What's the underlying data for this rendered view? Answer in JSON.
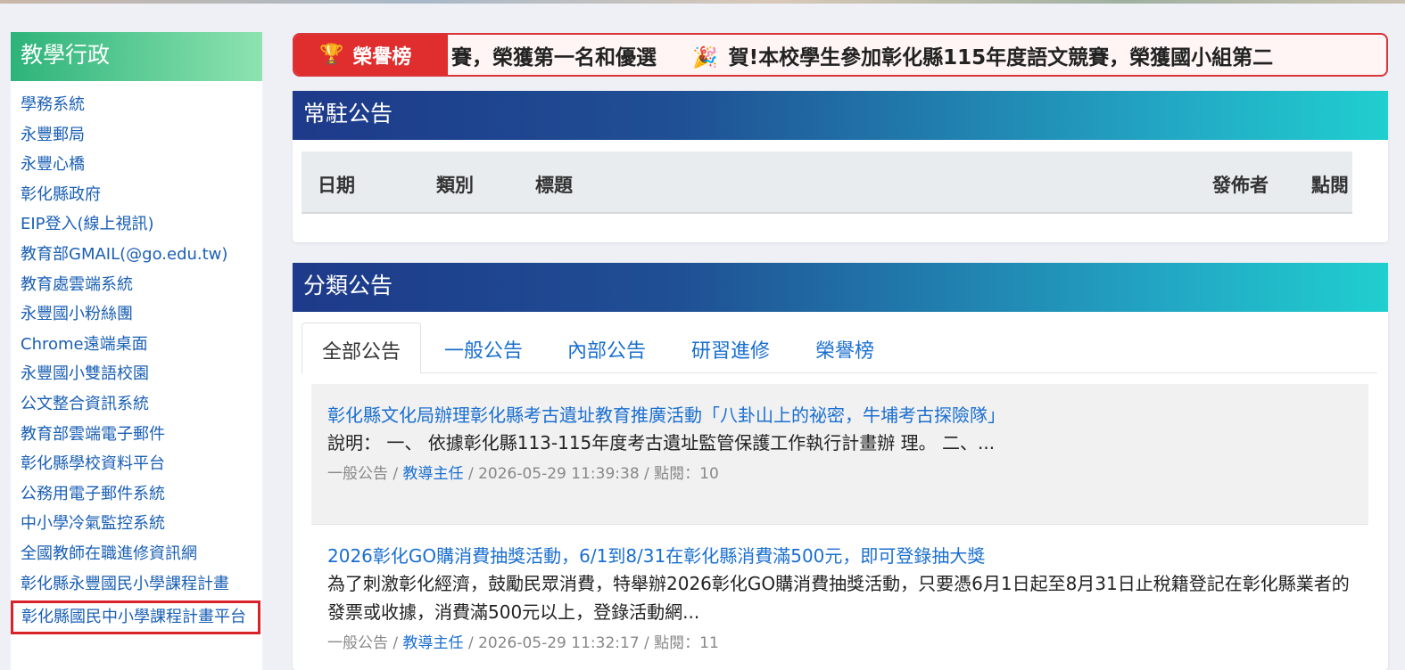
{
  "sidebar": {
    "title": "教學行政",
    "items": [
      {
        "label": "學務系統"
      },
      {
        "label": "永豐郵局"
      },
      {
        "label": "永豐心橋"
      },
      {
        "label": "彰化縣政府"
      },
      {
        "label": "EIP登入(線上視訊)"
      },
      {
        "label": "教育部GMAIL(@go.edu.tw)"
      },
      {
        "label": "教育處雲端系統"
      },
      {
        "label": "永豐國小粉絲團"
      },
      {
        "label": "Chrome遠端桌面"
      },
      {
        "label": "永豐國小雙語校園"
      },
      {
        "label": "公文整合資訊系統"
      },
      {
        "label": "教育部雲端電子郵件"
      },
      {
        "label": "彰化縣學校資料平台"
      },
      {
        "label": "公務用電子郵件系統"
      },
      {
        "label": "中小學冷氣監控系統"
      },
      {
        "label": "全國教師在職進修資訊網"
      },
      {
        "label": "彰化縣永豐國民小學課程計畫"
      },
      {
        "label": "彰化縣國民中小學課程計畫平台"
      }
    ]
  },
  "honor": {
    "label": "榮譽榜",
    "icon": "trophy-icon",
    "text1": "賽，榮獲第一名和優選",
    "text2": "賀!本校學生參加彰化縣115年度語文競賽，榮獲國小組第二"
  },
  "pinned": {
    "title": "常駐公告",
    "columns": {
      "date": "日期",
      "category": "類別",
      "subject": "標題",
      "publisher": "發佈者",
      "views": "點閱"
    }
  },
  "categorized": {
    "title": "分類公告",
    "tabs": [
      {
        "label": "全部公告"
      },
      {
        "label": "一般公告"
      },
      {
        "label": "內部公告"
      },
      {
        "label": "研習進修"
      },
      {
        "label": "榮譽榜"
      }
    ],
    "posts": [
      {
        "title": "彰化縣文化局辦理彰化縣考古遺址教育推廣活動「八卦山上的祕密，牛埔考古探險隊」",
        "desc": "說明： 一、 依據彰化縣113-115年度考古遺址監管保護工作執行計畫辦 理。 二、...",
        "category": "一般公告",
        "author": "教導主任",
        "meta": " / 2026-05-29 11:39:38 / 點閱：10"
      },
      {
        "title": "2026彰化GO購消費抽獎活動，6/1到8/31在彰化縣消費滿500元，即可登錄抽大獎",
        "desc": "為了刺激彰化經濟，鼓勵民眾消費，特舉辦2026彰化GO購消費抽獎活動，只要憑6月1日起至8月31日止稅籍登記在彰化縣業者的發票或收據，消費滿500元以上，登錄活動網...",
        "category": "一般公告",
        "author": "教導主任",
        "meta": " / 2026-05-29 11:32:17 / 點閱：11"
      }
    ]
  },
  "colors": {
    "accent_blue": "#1a6fd0",
    "honor_red": "#e02d2d",
    "sidebar_green": "#2db37a"
  }
}
